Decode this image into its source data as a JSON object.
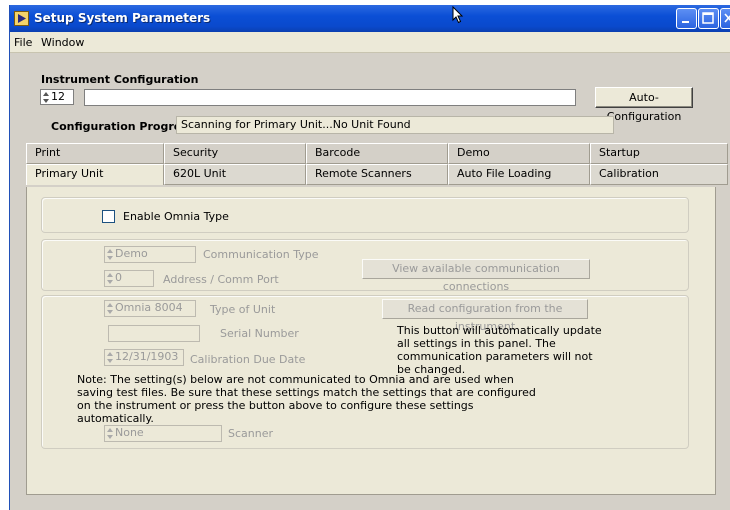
{
  "window": {
    "title": "Setup System Parameters"
  },
  "menu": {
    "items": [
      "File",
      "Window"
    ]
  },
  "instrument": {
    "heading": "Instrument Configuration",
    "number": "12",
    "name_value": "",
    "auto_config_label": "Auto-Configuration",
    "progress_label": "Configuration Progress:",
    "progress_text": "Scanning for Primary Unit...No Unit Found"
  },
  "tabs": {
    "row1": [
      "Print",
      "Security",
      "Barcode",
      "Demo",
      "Startup"
    ],
    "row2": [
      "Primary Unit",
      "620L Unit",
      "Remote Scanners",
      "Auto File Loading",
      "Calibration"
    ],
    "active": "Primary Unit"
  },
  "primary_unit": {
    "enable_omnia_label": "Enable Omnia Type",
    "enable_omnia_checked": false,
    "comm_type_value": "Demo",
    "comm_type_label": "Communication Type",
    "address_value": "0",
    "address_label": "Address / Comm Port",
    "view_connections_label": "View available communication connections",
    "unit_type_value": "Omnia 8004",
    "unit_type_label": "Type of Unit",
    "serial_value": "",
    "serial_label": "Serial Number",
    "cal_due_value": "12/31/1903",
    "cal_due_label": "Calibration Due Date",
    "read_config_label": "Read configuration from the instrument",
    "read_config_help": "This button will automatically update all settings in this panel.  The communication parameters will not be changed.",
    "note_text": "Note: The setting(s) below are not communicated to Omnia and are used when saving test files.  Be sure that these settings match the settings that are configured on the instrument or press the button above to configure these settings automatically.",
    "scanner_value": "None",
    "scanner_label": "Scanner"
  },
  "colors": {
    "titlebar": "#0b4fd6",
    "panel": "#d4d0c8",
    "tabpage": "#ece9d8"
  }
}
